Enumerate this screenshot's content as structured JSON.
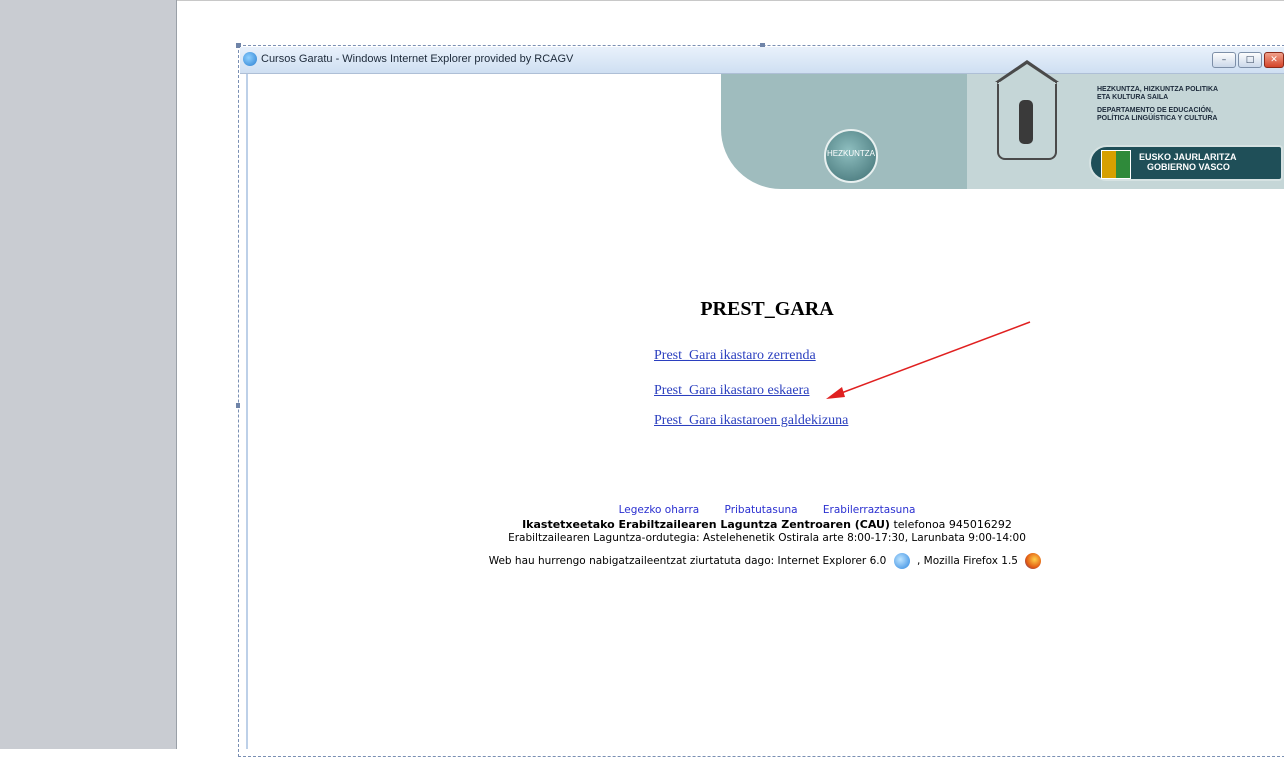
{
  "window": {
    "title": "Cursos Garatu - Windows Internet Explorer provided by RCAGV",
    "minimize_glyph": "–",
    "maximize_glyph": "□",
    "close_glyph": "✕"
  },
  "banner": {
    "badge_text": "HEZKUNTZA",
    "dept_eu_1": "HEZKUNTZA, HIZKUNTZA POLITIKA",
    "dept_eu_2": "ETA KULTURA SAILA",
    "dept_es_1": "DEPARTAMENTO DE EDUCACIÓN,",
    "dept_es_2": "POLÍTICA LINGÜÍSTICA Y CULTURA",
    "gov_1": "EUSKO JAURLARITZA",
    "gov_2": "GOBIERNO VASCO"
  },
  "page": {
    "title": "PREST_GARA",
    "links": [
      "Prest_Gara ikastaro zerrenda",
      "Prest_Gara ikastaro eskaera",
      "Prest_Gara ikastaroen galdekizuna"
    ]
  },
  "footer": {
    "links": [
      "Legezko oharra",
      "Pribatutasuna",
      "Erabilerraztasuna"
    ],
    "cau_bold": "Ikastetxeetako Erabiltzailearen Laguntza Zentroaren (CAU)",
    "cau_phone": " telefonoa 945016292",
    "hours": "Erabiltzailearen Laguntza-ordutegia: Astelehenetik Ostirala arte 8:00-17:30, Larunbata 9:00-14:00",
    "browsers_prefix": "Web hau hurrengo nabigatzaileentzat ziurtatuta dago: Internet Explorer 6.0",
    "browsers_suffix": ", Mozilla Firefox 1.5"
  },
  "colors": {
    "link": "#2b3fbf",
    "footer_link": "#2a2fd0",
    "annotation_arrow": "#e02020",
    "banner": "#9fbcbe"
  },
  "icons": {
    "ie_logo": "ie-logo-icon",
    "firefox_logo": "firefox-icon"
  }
}
